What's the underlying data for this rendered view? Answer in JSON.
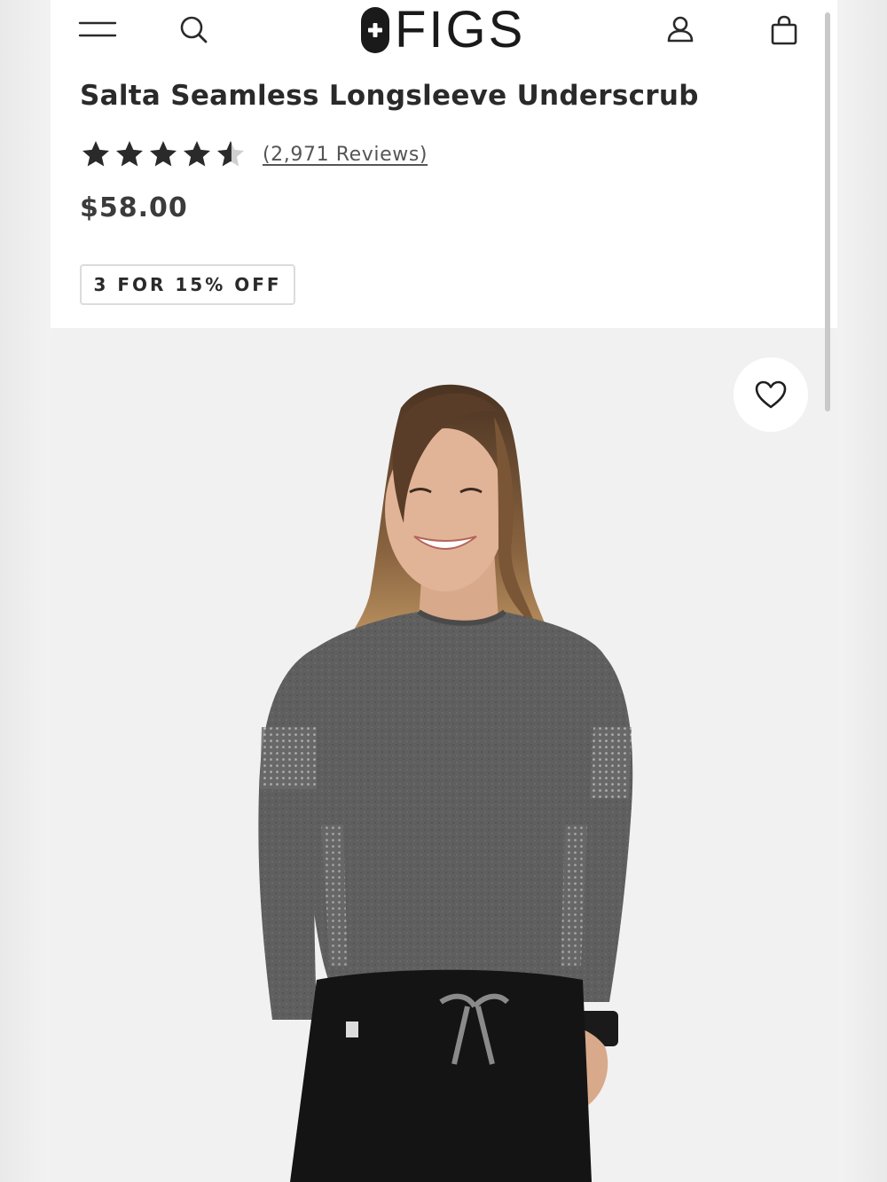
{
  "header": {
    "brand": "FIGS",
    "icons": {
      "menu": "hamburger-menu-icon",
      "search": "search-icon",
      "account": "user-icon",
      "bag": "shopping-bag-icon",
      "logo": "medical-cross-icon"
    }
  },
  "product": {
    "title": "Salta Seamless Longsleeve Underscrub",
    "rating": 4.5,
    "rating_max": 5,
    "reviews_label": "(2,971 Reviews)",
    "price": "$58.00",
    "promo": "3 FOR 15% OFF"
  },
  "gallery": {
    "wishlist_icon": "heart-icon",
    "image_alt": "Model wearing heathered gray seamless longsleeve underscrub with black scrub pants"
  },
  "colors": {
    "text_dark": "#2a2a2a",
    "price": "#3b3b3b",
    "shirt": "#5e5e5e",
    "pants": "#141414",
    "background": "#f1f1f1"
  }
}
